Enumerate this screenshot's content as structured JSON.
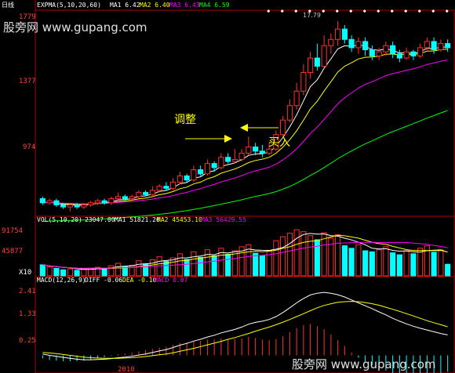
{
  "period_label": "日线",
  "watermark_top": "股旁网 www.gupang.com",
  "watermark_bottom": "股旁网 www.gupang.com",
  "price_panel": {
    "indicator_name": "EXPMA(5,10,20,60)",
    "ma_labels": [
      "MA1 6.42",
      "MA2 6.40",
      "MA3 6.43",
      "MA4 6.59"
    ],
    "ma_colors": [
      "#ffffff",
      "#ffff00",
      "#ff00ff",
      "#00ff00"
    ],
    "y_ticks": [
      "1779",
      "1377",
      "974"
    ],
    "peak_label": "17.79",
    "annot_adjust": "调整",
    "annot_buy": "买入"
  },
  "vol_panel": {
    "indicator_name": "VOL(5,10,20)",
    "values_text": [
      "23047.00",
      "MA1 51821.20",
      "MA2 45453.10",
      "MA3 56429.55"
    ],
    "y_ticks": [
      "91754",
      "45877",
      "X10"
    ]
  },
  "macd_panel": {
    "indicator_name": "MACD(12,26,9)",
    "values_text": [
      "DIFF -0.06",
      "DEA -0.10",
      "MACD 0.07"
    ],
    "y_ticks": [
      "2.41",
      "1.33",
      "0.25"
    ],
    "bottom_label": "2010"
  },
  "chart_data": [
    {
      "type": "candlestick",
      "title": "EXPMA(5,10,20,60)",
      "ylim": [
        8.5,
        18.2
      ],
      "y_ticks": [
        17.79,
        13.77,
        9.74
      ],
      "series_lines": [
        "EXPMA5",
        "EXPMA10",
        "EXPMA20",
        "EXPMA60"
      ],
      "candles": [
        [
          9.2,
          9.0,
          9.3,
          8.9
        ],
        [
          9.0,
          9.1,
          9.2,
          8.9
        ],
        [
          9.1,
          8.9,
          9.2,
          8.8
        ],
        [
          8.9,
          8.8,
          9.0,
          8.7
        ],
        [
          8.8,
          8.9,
          9.0,
          8.6
        ],
        [
          8.9,
          8.8,
          9.0,
          8.7
        ],
        [
          8.8,
          8.9,
          9.0,
          8.7
        ],
        [
          8.9,
          9.0,
          9.1,
          8.8
        ],
        [
          9.0,
          9.1,
          9.2,
          8.9
        ],
        [
          9.1,
          9.0,
          9.2,
          8.9
        ],
        [
          9.0,
          9.2,
          9.3,
          8.9
        ],
        [
          9.2,
          9.3,
          9.5,
          9.1
        ],
        [
          9.3,
          9.2,
          9.4,
          9.1
        ],
        [
          9.2,
          9.3,
          9.4,
          9.1
        ],
        [
          9.3,
          9.5,
          9.6,
          9.2
        ],
        [
          9.5,
          9.4,
          9.6,
          9.3
        ],
        [
          9.4,
          9.6,
          9.8,
          9.3
        ],
        [
          9.6,
          9.8,
          9.9,
          9.5
        ],
        [
          9.8,
          9.7,
          10.0,
          9.6
        ],
        [
          9.7,
          10.0,
          10.2,
          9.6
        ],
        [
          10.0,
          10.3,
          10.5,
          9.9
        ],
        [
          10.3,
          10.1,
          10.4,
          10.0
        ],
        [
          10.1,
          10.6,
          10.8,
          10.0
        ],
        [
          10.6,
          10.4,
          10.8,
          10.3
        ],
        [
          10.4,
          10.9,
          11.1,
          10.3
        ],
        [
          10.9,
          10.7,
          11.0,
          10.5
        ],
        [
          10.7,
          11.2,
          11.4,
          10.6
        ],
        [
          11.2,
          11.0,
          11.4,
          10.9
        ],
        [
          11.0,
          11.1,
          11.6,
          10.9
        ],
        [
          11.1,
          11.4,
          11.6,
          11.0
        ],
        [
          11.4,
          11.7,
          12.2,
          11.3
        ],
        [
          11.7,
          11.5,
          11.9,
          11.3
        ],
        [
          11.5,
          11.4,
          11.8,
          11.2
        ],
        [
          11.4,
          11.6,
          11.9,
          11.3
        ],
        [
          11.6,
          12.3,
          12.5,
          11.5
        ],
        [
          12.3,
          13.0,
          13.2,
          12.2
        ],
        [
          13.0,
          13.7,
          14.0,
          12.9
        ],
        [
          13.7,
          14.4,
          14.8,
          13.5
        ],
        [
          14.4,
          15.3,
          15.7,
          14.2
        ],
        [
          15.3,
          16.0,
          16.3,
          15.0
        ],
        [
          16.0,
          15.6,
          16.7,
          15.4
        ],
        [
          15.6,
          16.6,
          17.1,
          15.5
        ],
        [
          16.6,
          16.9,
          17.2,
          16.2
        ],
        [
          16.9,
          17.4,
          17.79,
          16.6
        ],
        [
          17.4,
          16.9,
          17.6,
          16.7
        ],
        [
          16.9,
          16.5,
          17.1,
          16.3
        ],
        [
          16.5,
          16.8,
          17.0,
          16.2
        ],
        [
          16.8,
          16.4,
          17.0,
          16.1
        ],
        [
          16.4,
          16.1,
          16.6,
          15.9
        ],
        [
          16.1,
          16.3,
          16.5,
          15.9
        ],
        [
          16.3,
          16.6,
          16.8,
          16.1
        ],
        [
          16.6,
          16.2,
          16.8,
          16.0
        ],
        [
          16.2,
          16.0,
          16.4,
          15.8
        ],
        [
          16.0,
          16.3,
          16.5,
          15.9
        ],
        [
          16.3,
          16.1,
          16.4,
          15.9
        ],
        [
          16.1,
          16.5,
          16.7,
          16.0
        ],
        [
          16.5,
          16.8,
          17.0,
          16.3
        ],
        [
          16.8,
          16.4,
          17.0,
          16.2
        ],
        [
          16.4,
          16.7,
          16.9,
          16.3
        ],
        [
          16.7,
          16.5,
          16.9,
          16.3
        ]
      ]
    },
    {
      "type": "bar",
      "title": "VOL(5,10,20)",
      "ylim": [
        0,
        100000
      ],
      "y_ticks": [
        91754,
        45877
      ],
      "values": [
        22000,
        18000,
        15000,
        12000,
        14000,
        11000,
        13000,
        15000,
        17000,
        14000,
        20000,
        25000,
        19000,
        21000,
        30000,
        24000,
        32000,
        38000,
        29000,
        36000,
        44000,
        33000,
        48000,
        37000,
        52000,
        40000,
        55000,
        43000,
        50000,
        58000,
        62000,
        45000,
        40000,
        49000,
        70000,
        78000,
        85000,
        91754,
        88000,
        80000,
        72000,
        86000,
        75000,
        82000,
        60000,
        55000,
        62000,
        50000,
        48000,
        52000,
        58000,
        46000,
        42000,
        50000,
        44000,
        55000,
        60000,
        47000,
        52000,
        23047
      ]
    },
    {
      "type": "line",
      "title": "MACD(12,26,9)",
      "ylim": [
        -0.3,
        2.6
      ],
      "y_ticks": [
        2.41,
        1.33,
        0.25
      ],
      "diff": [
        0.3,
        0.25,
        0.22,
        0.18,
        0.15,
        0.12,
        0.1,
        0.1,
        0.11,
        0.12,
        0.14,
        0.17,
        0.19,
        0.22,
        0.26,
        0.3,
        0.35,
        0.4,
        0.45,
        0.52,
        0.6,
        0.66,
        0.74,
        0.8,
        0.88,
        0.94,
        1.02,
        1.08,
        1.14,
        1.22,
        1.32,
        1.38,
        1.42,
        1.48,
        1.58,
        1.72,
        1.88,
        2.05,
        2.2,
        2.32,
        2.38,
        2.41,
        2.38,
        2.33,
        2.25,
        2.15,
        2.05,
        1.95,
        1.85,
        1.74,
        1.64,
        1.52,
        1.42,
        1.33,
        1.25,
        1.18,
        1.12,
        1.06,
        1.0,
        0.95
      ],
      "dea": [
        0.35,
        0.33,
        0.31,
        0.28,
        0.25,
        0.22,
        0.19,
        0.17,
        0.16,
        0.15,
        0.15,
        0.15,
        0.16,
        0.17,
        0.19,
        0.21,
        0.24,
        0.27,
        0.3,
        0.34,
        0.39,
        0.44,
        0.49,
        0.55,
        0.61,
        0.67,
        0.73,
        0.8,
        0.86,
        0.93,
        1.0,
        1.08,
        1.15,
        1.22,
        1.3,
        1.39,
        1.48,
        1.58,
        1.68,
        1.78,
        1.88,
        1.96,
        2.02,
        2.07,
        2.09,
        2.1,
        2.09,
        2.06,
        2.02,
        1.97,
        1.9,
        1.83,
        1.76,
        1.68,
        1.6,
        1.52,
        1.44,
        1.37,
        1.3,
        1.23
      ]
    }
  ]
}
